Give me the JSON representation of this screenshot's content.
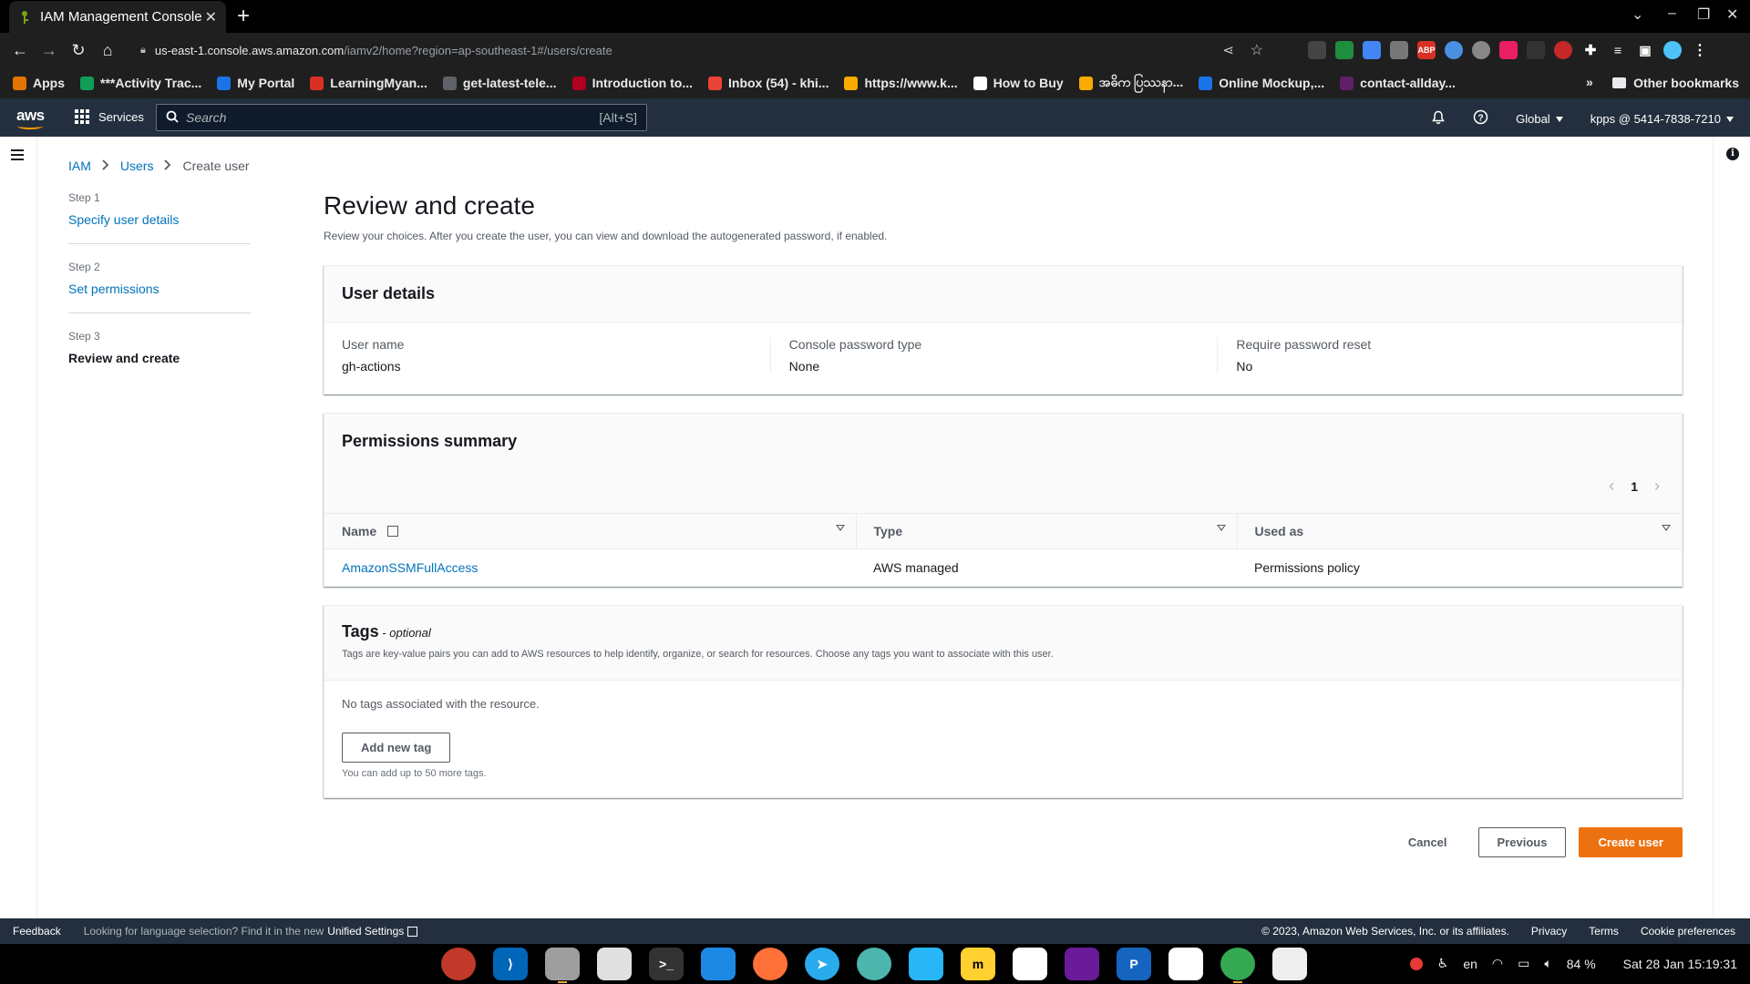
{
  "browser": {
    "tab_title": "IAM Management Console",
    "url_host": "us-east-1.console.aws.amazon.com",
    "url_path": "/iamv2/home?region=ap-southeast-1#/users/create",
    "bookmarks": [
      {
        "label": "Apps",
        "color": "#e37400"
      },
      {
        "label": "***Activity Trac...",
        "color": "#0f9d58"
      },
      {
        "label": "My Portal",
        "color": "#1a73e8"
      },
      {
        "label": "LearningMyan...",
        "color": "#d93025"
      },
      {
        "label": "get-latest-tele...",
        "color": "#5f6368"
      },
      {
        "label": "Introduction to...",
        "color": "#b00020"
      },
      {
        "label": "Inbox (54) - khi...",
        "color": "#ea4335"
      },
      {
        "label": "https://www.k...",
        "color": "#f9ab00"
      },
      {
        "label": "How to Buy",
        "color": "#ffffff"
      },
      {
        "label": "အဓိက ပြဿနာ...",
        "color": "#f9ab00"
      },
      {
        "label": "Online Mockup,...",
        "color": "#1a73e8"
      },
      {
        "label": "contact-allday...",
        "color": "#611f69"
      }
    ],
    "other_bookmarks": "Other bookmarks"
  },
  "aws_nav": {
    "logo": "aws",
    "services": "Services",
    "search_placeholder": "Search",
    "search_shortcut": "[Alt+S]",
    "region": "Global",
    "account": "kpps @ 5414-7838-7210"
  },
  "breadcrumb": {
    "iam": "IAM",
    "users": "Users",
    "current": "Create user"
  },
  "steps": [
    {
      "num": "Step 1",
      "label": "Specify user details"
    },
    {
      "num": "Step 2",
      "label": "Set permissions"
    },
    {
      "num": "Step 3",
      "label": "Review and create"
    }
  ],
  "page": {
    "title": "Review and create",
    "description": "Review your choices. After you create the user, you can view and download the autogenerated password, if enabled."
  },
  "user_details": {
    "heading": "User details",
    "fields": [
      {
        "label": "User name",
        "value": "gh-actions"
      },
      {
        "label": "Console password type",
        "value": "None"
      },
      {
        "label": "Require password reset",
        "value": "No"
      }
    ]
  },
  "permissions": {
    "heading": "Permissions summary",
    "page_number": "1",
    "columns": [
      "Name",
      "Type",
      "Used as"
    ],
    "rows": [
      {
        "name": "AmazonSSMFullAccess",
        "type": "AWS managed",
        "used_as": "Permissions policy"
      }
    ]
  },
  "tags": {
    "heading": "Tags",
    "optional": " - optional",
    "description": "Tags are key-value pairs you can add to AWS resources to help identify, organize, or search for resources. Choose any tags you want to associate with this user.",
    "empty": "No tags associated with the resource.",
    "add_button": "Add new tag",
    "hint": "You can add up to 50 more tags."
  },
  "actions": {
    "cancel": "Cancel",
    "previous": "Previous",
    "create": "Create user"
  },
  "footer": {
    "feedback": "Feedback",
    "language_note": "Looking for language selection? Find it in the new",
    "unified_settings": "Unified Settings",
    "copyright": "© 2023, Amazon Web Services, Inc. or its affiliates.",
    "privacy": "Privacy",
    "terms": "Terms",
    "cookies": "Cookie preferences"
  },
  "taskbar": {
    "lang": "en",
    "battery": "84 %",
    "datetime": "Sat 28 Jan  15:19:31"
  },
  "colors": {
    "aws_nav_bg": "#232f3e",
    "primary_button": "#ec7211",
    "link": "#0073bb"
  }
}
